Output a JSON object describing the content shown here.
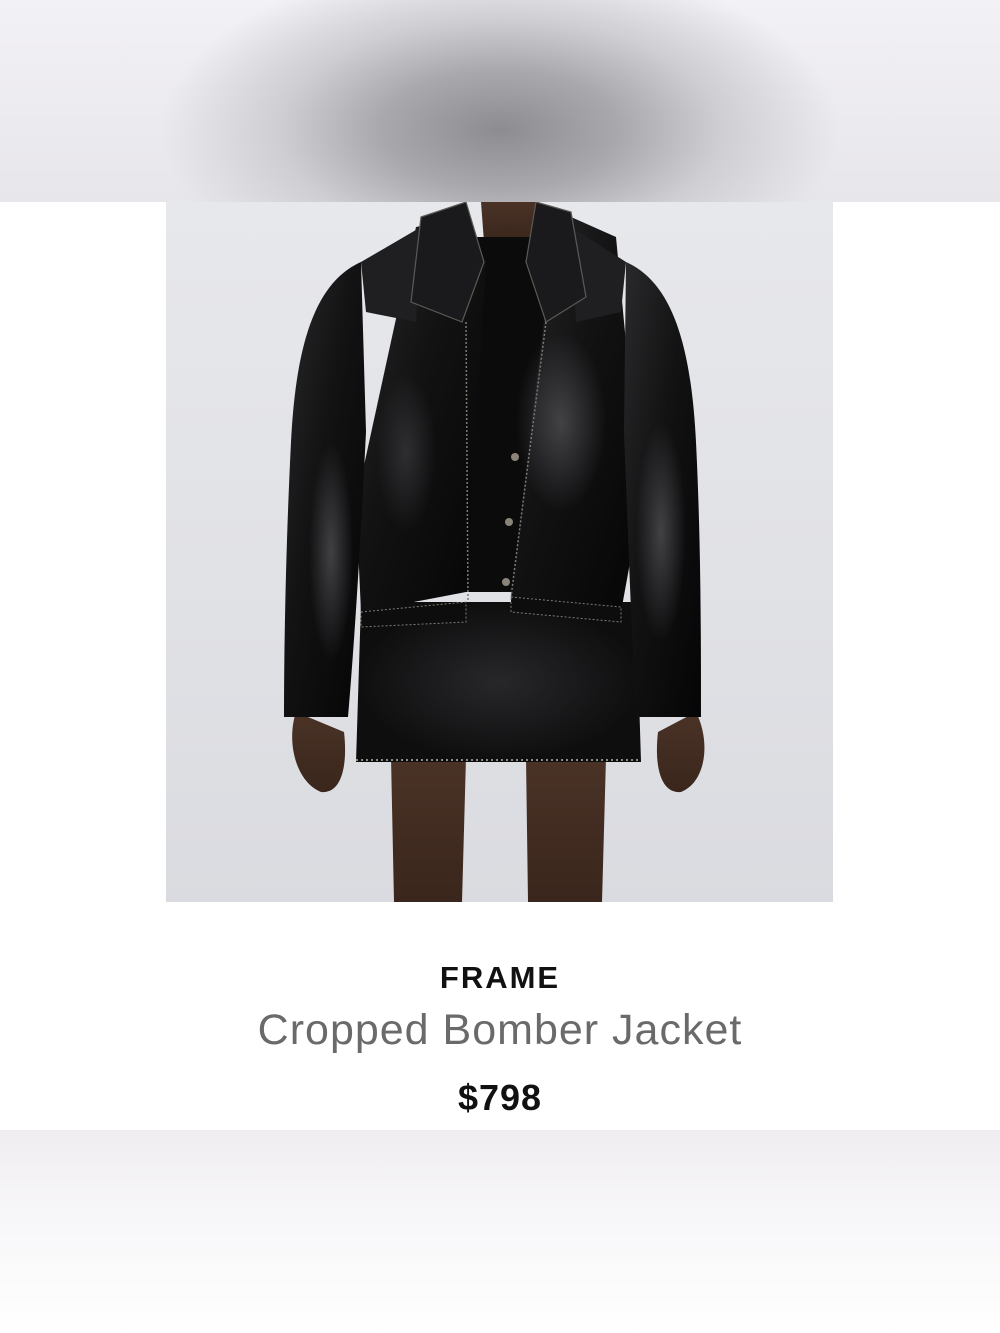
{
  "product": {
    "image_alt": "Model wearing black leather cropped bomber jacket with leather mini skirt",
    "brand": "FRAME",
    "name": "Cropped Bomber Jacket",
    "price": "$798"
  },
  "colors": {
    "background": "#ffffff",
    "image_backdrop": "#e3e4e8",
    "brand_text": "#111111",
    "name_text": "#6a6a6a",
    "price_text": "#111111"
  }
}
